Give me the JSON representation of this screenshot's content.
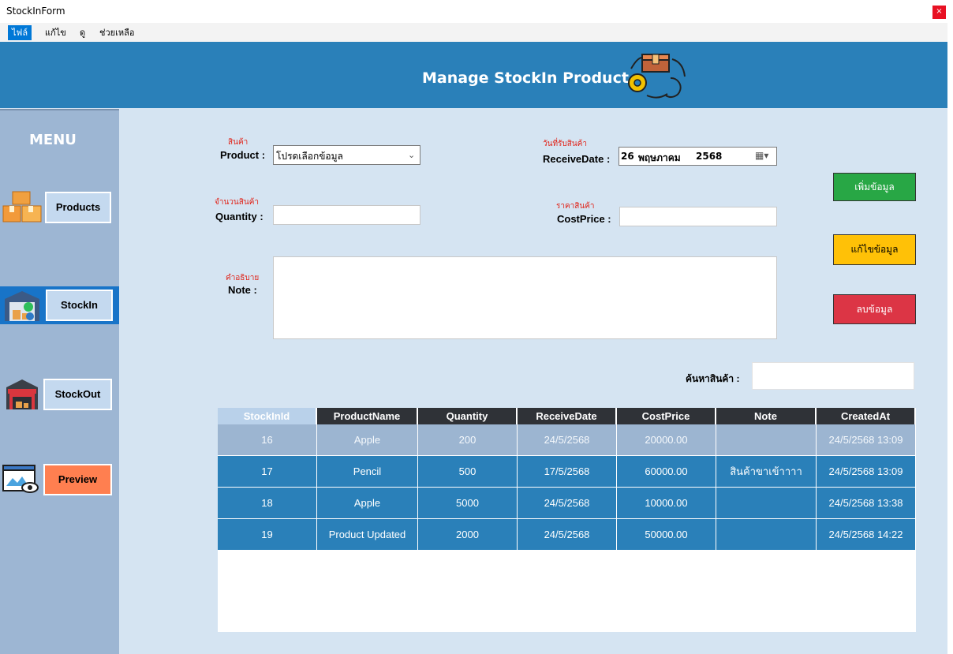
{
  "window": {
    "title": "StockInForm",
    "close_glyph": "×"
  },
  "menubar": {
    "items": [
      "ไฟล์",
      "แก้ไข",
      "ดู",
      "ช่วยเหลือ"
    ]
  },
  "header": {
    "title": "Manage StockIn Product",
    "icon": "box-gears-cycle-icon"
  },
  "sidebar": {
    "title": "MENU",
    "items": [
      {
        "label": "Products",
        "icon": "boxes-icon",
        "color": "#c4d9ef"
      },
      {
        "label": "StockIn",
        "icon": "warehouse-in-icon",
        "color": "#c4d9ef"
      },
      {
        "label": "StockOut",
        "icon": "warehouse-out-icon",
        "color": "#c4d9ef"
      },
      {
        "label": "Preview",
        "icon": "preview-eye-icon",
        "color": "#ff7f50"
      }
    ]
  },
  "form": {
    "product": {
      "thai_label": "สินค้า",
      "label": "Product :",
      "value": "โปรดเลือกข้อมูล"
    },
    "quantity": {
      "thai_label": "จำนวนสินค้า",
      "label": "Quantity :",
      "value": ""
    },
    "note": {
      "thai_label": "คำอธิบาย",
      "label": "Note :",
      "value": ""
    },
    "receive_date": {
      "thai_label": "วันที่รับสินค้า",
      "label": "ReceiveDate :",
      "day": "26",
      "month": "พฤษภาคม",
      "year": "2568"
    },
    "cost_price": {
      "thai_label": "ราคาสินค้า",
      "label": "CostPrice :",
      "value": ""
    },
    "search": {
      "label": "ค้นหาสินค้า :",
      "value": ""
    }
  },
  "actions": {
    "add": {
      "label": "เพิ่มข้อมูล",
      "color": "#28a745"
    },
    "edit": {
      "label": "แก้ไขข้อมูล",
      "color": "#ffc107"
    },
    "delete": {
      "label": "ลบข้อมูล",
      "color": "#dc3545"
    }
  },
  "table": {
    "columns": [
      "StockInId",
      "ProductName",
      "Quantity",
      "ReceiveDate",
      "CostPrice",
      "Note",
      "CreatedAt"
    ],
    "rows": [
      [
        "16",
        "Apple",
        "200",
        "24/5/2568",
        "20000.00",
        "",
        "24/5/2568 13:09"
      ],
      [
        "17",
        "Pencil",
        "500",
        "17/5/2568",
        "60000.00",
        "สินค้าขาเข้าาาา",
        "24/5/2568 13:09"
      ],
      [
        "18",
        "Apple",
        "5000",
        "24/5/2568",
        "10000.00",
        "",
        "24/5/2568 13:38"
      ],
      [
        "19",
        "Product Updated",
        "2000",
        "24/5/2568",
        "50000.00",
        "",
        "24/5/2568 14:22"
      ]
    ]
  }
}
